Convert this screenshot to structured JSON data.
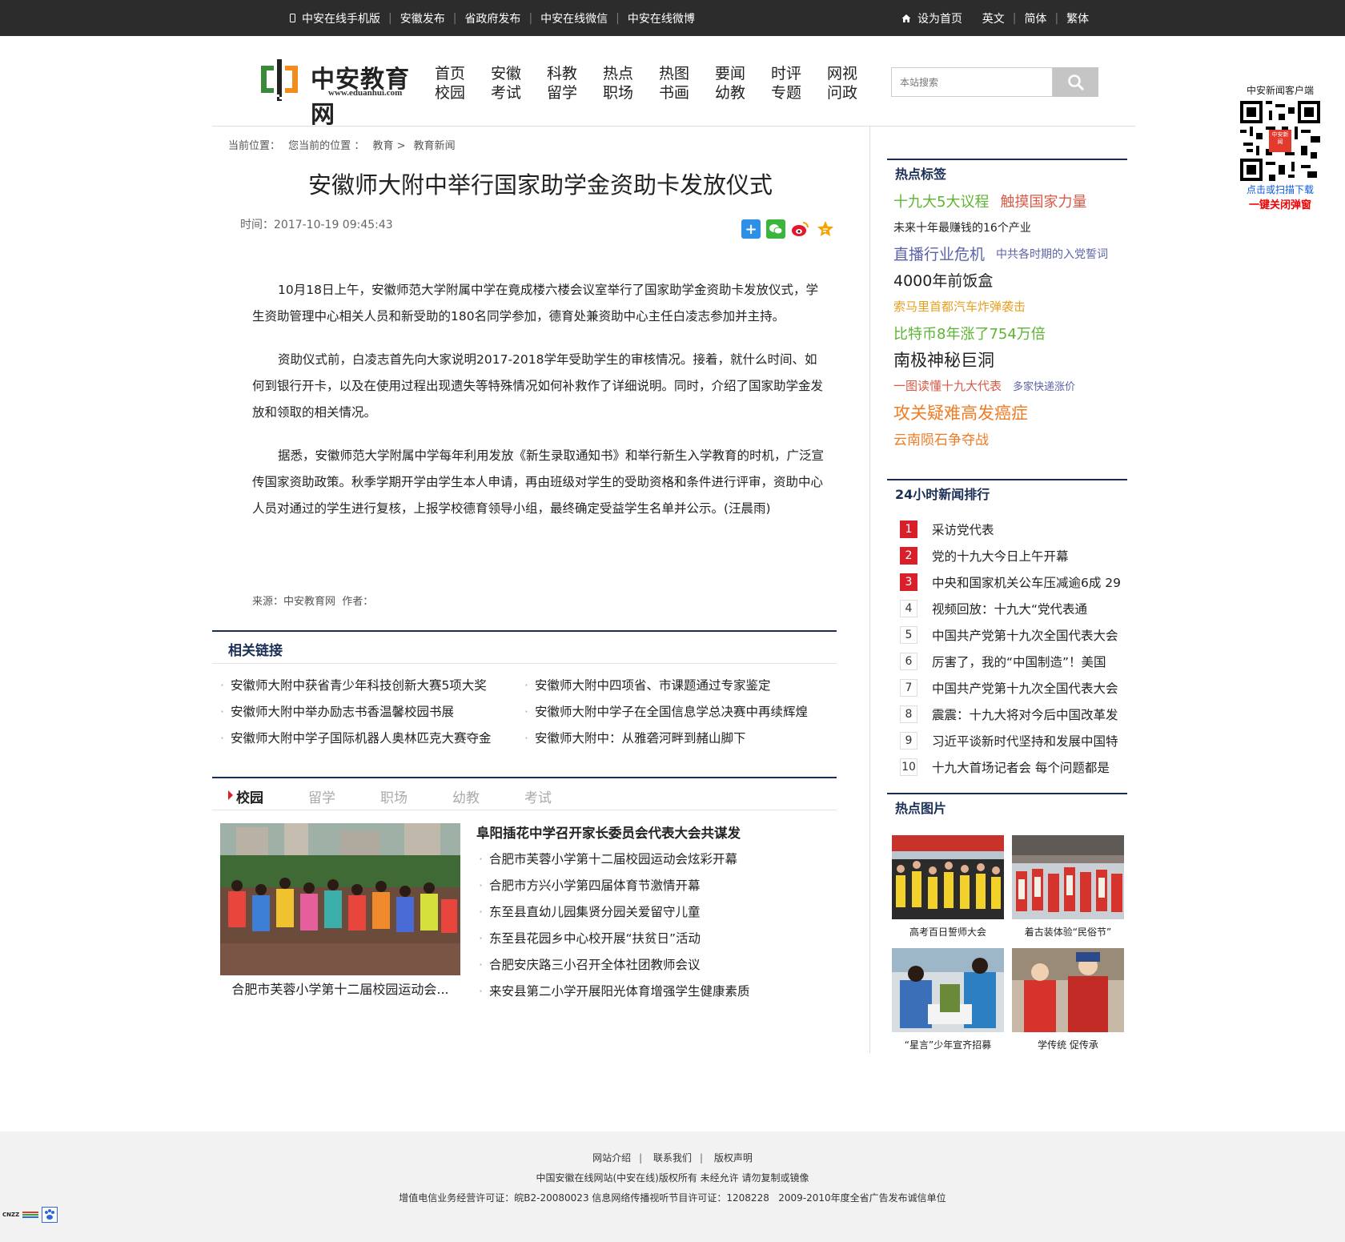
{
  "topbar": {
    "left_links": [
      "中安在线手机版",
      "安徽发布",
      "省政府发布",
      "中安在线微信",
      "中安在线微博"
    ],
    "home_link": "设为首页",
    "right_links": [
      "英文",
      "简体",
      "繁体"
    ]
  },
  "logo": {
    "name": "中安教育网",
    "url": "www.eduanhui.com"
  },
  "nav": [
    [
      "首页",
      "校园"
    ],
    [
      "安徽",
      "考试"
    ],
    [
      "科教",
      "留学"
    ],
    [
      "热点",
      "职场"
    ],
    [
      "热图",
      "书画"
    ],
    [
      "要闻",
      "幼教"
    ],
    [
      "时评",
      "专题"
    ],
    [
      "网视",
      "问政"
    ]
  ],
  "search": {
    "placeholder": "本站搜索"
  },
  "qr": {
    "title": "中安新闻客户端",
    "badge": "中安新闻",
    "line1": "点击或扫描下载",
    "line2": "一键关闭弹窗"
  },
  "breadcrumb": [
    "当前位置：",
    "您当前的位置",
    "：",
    "教育",
    ">",
    "教育新闻"
  ],
  "article": {
    "title": "安徽师大附中举行国家助学金资助卡发放仪式",
    "time": "时间：2017-10-19 09:45:43",
    "paragraphs": [
      "10月18日上午，安徽师范大学附属中学在竟成楼六楼会议室举行了国家助学金资助卡发放仪式，学生资助管理中心相关人员和新受助的180名同学参加，德育处兼资助中心主任白凌志参加并主持。",
      "资助仪式前，白凌志首先向大家说明2017-2018学年受助学生的审核情况。接着，就什么时间、如何到银行开卡，以及在使用过程出现遗失等特殊情况如何补救作了详细说明。同时，介绍了国家助学金发放和领取的相关情况。",
      "据悉，安徽师范大学附属中学每年利用发放《新生录取通知书》和举行新生入学教育的时机，广泛宣传国家资助政策。秋季学期开学由学生本人申请，再由班级对学生的受助资格和条件进行评审，资助中心人员对通过的学生进行复核，上报学校德育领导小组，最终确定受益学生名单并公示。(汪晨雨)"
    ],
    "source": "来源：中安教育网  作者："
  },
  "related": {
    "heading": "相关链接",
    "links": [
      "安徽师大附中获省青少年科技创新大赛5项大奖",
      "安徽师大附中四项省、市课题通过专家鉴定",
      "安徽师大附中举办励志书香温馨校园书展",
      "安徽师大附中学子在全国信息学总决赛中再续辉煌",
      "安徽师大附中学子国际机器人奥林匹克大赛夺金",
      "安徽师大附中：从雅砻河畔到赭山脚下"
    ]
  },
  "tabs": [
    "校园",
    "留学",
    "职场",
    "幼教",
    "考试"
  ],
  "campus": {
    "photo_caption": "合肥市芙蓉小学第十二届校园运动会...",
    "headline": "阜阳插花中学召开家长委员会代表大会共谋发",
    "items": [
      "合肥市芙蓉小学第十二届校园运动会炫彩开幕",
      "合肥市方兴小学第四届体育节激情开幕",
      "东至县直幼儿园集贤分园关爱留守儿童",
      "东至县花园乡中心校开展“扶贫日”活动",
      "合肥安庆路三小召开全体社团教师会议",
      "来安县第二小学开展阳光体育增强学生健康素质"
    ]
  },
  "sidebar": {
    "hot_tags_heading": "热点标签",
    "tags": [
      [
        {
          "text": "十九大5大议程",
          "color": "#5cb531",
          "size": 18
        },
        {
          "text": "触摸国家力量",
          "color": "#d85a46",
          "size": 18
        }
      ],
      [
        {
          "text": "未来十年最赚钱的16个产业",
          "color": "#222222",
          "size": 14
        }
      ],
      [
        {
          "text": "直播行业危机",
          "color": "#5c63a8",
          "size": 19
        },
        {
          "text": "中共各时期的入党誓词",
          "color": "#5c63a8",
          "size": 14
        }
      ],
      [
        {
          "text": "4000年前饭盒",
          "color": "#222222",
          "size": 19
        }
      ],
      [
        {
          "text": "索马里首都汽车炸弹袭击",
          "color": "#e6a020",
          "size": 15
        }
      ],
      [
        {
          "text": "比特币8年涨了754万倍",
          "color": "#5cb531",
          "size": 18
        }
      ],
      [
        {
          "text": "南极神秘巨洞",
          "color": "#222222",
          "size": 21
        }
      ],
      [
        {
          "text": "一图读懂十九大代表",
          "color": "#d85a46",
          "size": 15
        },
        {
          "text": "多家快递涨价",
          "color": "#5c63a8",
          "size": 13
        }
      ],
      [
        {
          "text": "攻关疑难高发癌症",
          "color": "#f07c24",
          "size": 21
        }
      ],
      [
        {
          "text": "云南陨石争夺战",
          "color": "#f07c24",
          "size": 17
        }
      ]
    ],
    "rank_heading": "24小时新闻排行",
    "rank": [
      {
        "n": "1",
        "t": "采访党代表"
      },
      {
        "n": "2",
        "t": "党的十九大今日上午开幕"
      },
      {
        "n": "3",
        "t": "中央和国家机关公车压减逾6成 29"
      },
      {
        "n": "4",
        "t": "视频回放：十九大“党代表通"
      },
      {
        "n": "5",
        "t": "中国共产党第十九次全国代表大会"
      },
      {
        "n": "6",
        "t": "厉害了，我的“中国制造”！美国"
      },
      {
        "n": "7",
        "t": "中国共产党第十九次全国代表大会"
      },
      {
        "n": "8",
        "t": "震震：十九大将对今后中国改革发"
      },
      {
        "n": "9",
        "t": "习近平谈新时代坚持和发展中国特"
      },
      {
        "n": "10",
        "t": "十九大首场记者会 每个问题都是"
      }
    ],
    "pics_heading": "热点图片",
    "pics": [
      "高考百日誓师大会",
      "着古装体验“民俗节”",
      "“星言”少年宣齐招募",
      "学传统 促传承"
    ]
  },
  "footer": {
    "links": [
      "网站介绍",
      "联系我们",
      "版权声明"
    ],
    "copyright": "中国安徽在线网站(中安在线)版权所有 未经允许 请勿复制或镜像",
    "license": "增值电信业务经营许可证：皖B2-20080023 信息网络传播视听节目许可证：1208228   2009-2010年度全省广告发布诚信单位",
    "badge": "CNZZ"
  }
}
